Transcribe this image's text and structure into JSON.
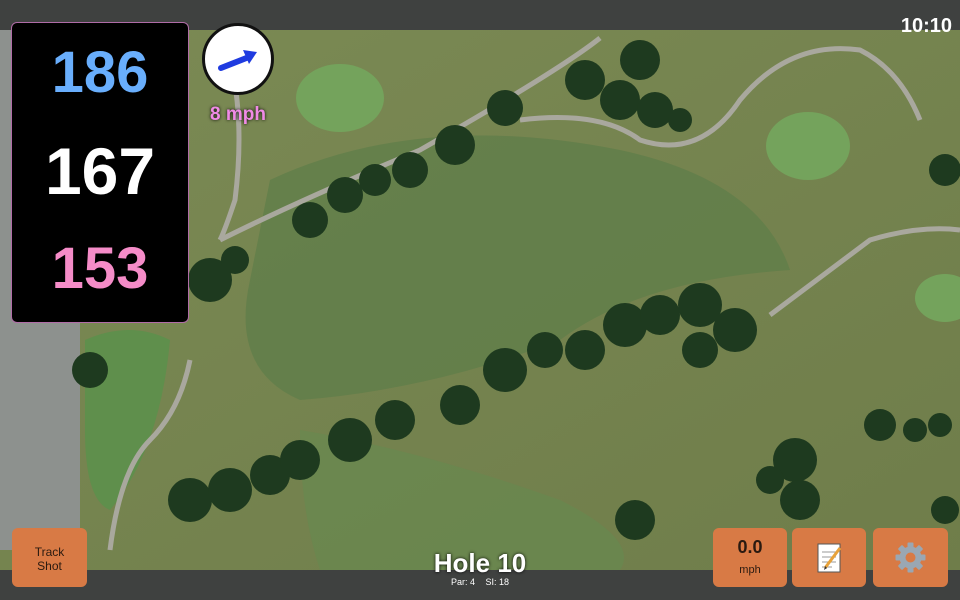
{
  "status": {
    "time": "10:10"
  },
  "yardage": {
    "back": "186",
    "middle": "167",
    "front": "153"
  },
  "wind": {
    "speed": "8 mph",
    "direction_icon": "wind-arrow-icon"
  },
  "buttons": {
    "track_shot": [
      "Track",
      "Shot"
    ],
    "speed_value": "0.0",
    "speed_unit": "mph",
    "notes_icon": "notepad-icon",
    "settings_icon": "gear-icon"
  },
  "hole": {
    "title": "Hole 10",
    "par": "Par: 4",
    "stroke_index": "SI: 18"
  },
  "colors": {
    "button": "#d87a45",
    "back_yardage": "#69aefc",
    "front_yardage": "#f58cc8",
    "wind_text": "#f08ae6"
  }
}
